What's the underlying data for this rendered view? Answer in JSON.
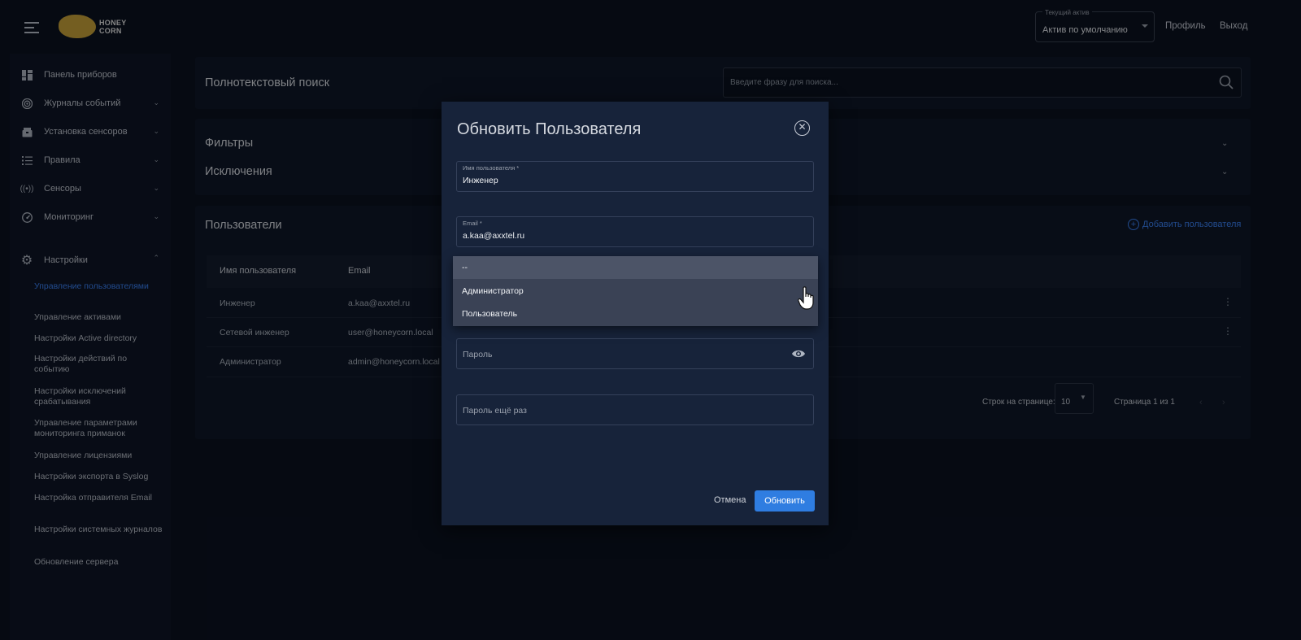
{
  "header": {
    "logo_text_line1": "HONEY",
    "logo_text_line2": "CORN",
    "asset_label": "Текущий актив",
    "asset_value": "Актив по умолчанию",
    "profile_link": "Профиль",
    "logout_link": "Выход"
  },
  "sidebar": {
    "items": [
      {
        "label": "Панель приборов",
        "icon": "dashboard-icon"
      },
      {
        "label": "Журналы событий",
        "icon": "target-icon"
      },
      {
        "label": "Установка сенсоров",
        "icon": "box-icon"
      },
      {
        "label": "Правила",
        "icon": "list-icon"
      },
      {
        "label": "Сенсоры",
        "icon": "broadcast-icon"
      },
      {
        "label": "Мониторинг",
        "icon": "gauge-icon"
      },
      {
        "label": "Настройки",
        "icon": "gear-icon"
      }
    ],
    "settings_subitems": [
      "Управление пользователями",
      "Управление активами",
      "Настройки Active directory",
      "Настройки действий по событию",
      "Настройки исключений срабатывания",
      "Управление параметрами мониторинга приманок",
      "Управление лицензиями",
      "Настройки экспорта в Syslog",
      "Настройка отправителя Email",
      "Настройки системных журналов",
      "Обновление сервера"
    ]
  },
  "search": {
    "title": "Полнотекстовый поиск",
    "placeholder": "Введите фразу для поиска..."
  },
  "filters": {
    "filters_label": "Фильтры",
    "exclusions_label": "Исключения"
  },
  "users": {
    "title": "Пользователи",
    "add_button": "Добавить пользователя",
    "columns": [
      "Имя пользователя",
      "Email"
    ],
    "rows": [
      {
        "name": "Инженер",
        "email": "a.kaa@axxtel.ru"
      },
      {
        "name": "Сетевой инженер",
        "email": "user@honeycorn.local"
      },
      {
        "name": "Администратор",
        "email": "admin@honeycorn.local"
      }
    ],
    "rows_per_page_label": "Строк на странице:",
    "rows_per_page_value": "10",
    "page_info": "Страница 1 из 1"
  },
  "modal": {
    "title": "Обновить Пользователя",
    "username_label": "Имя пользователя *",
    "username_value": "Инженер",
    "email_label": "Email *",
    "email_value": "a.kaa@axxtel.ru",
    "role_options": [
      "--",
      "Администратор",
      "Пользователь"
    ],
    "password_placeholder": "Пароль",
    "password_repeat_placeholder": "Пароль ещё раз",
    "cancel_label": "Отмена",
    "submit_label": "Обновить"
  },
  "colors": {
    "accent": "#2f7de1",
    "link": "#3b82f6",
    "background": "#0b1220",
    "panel": "#0f1828",
    "modal": "#17233a"
  }
}
